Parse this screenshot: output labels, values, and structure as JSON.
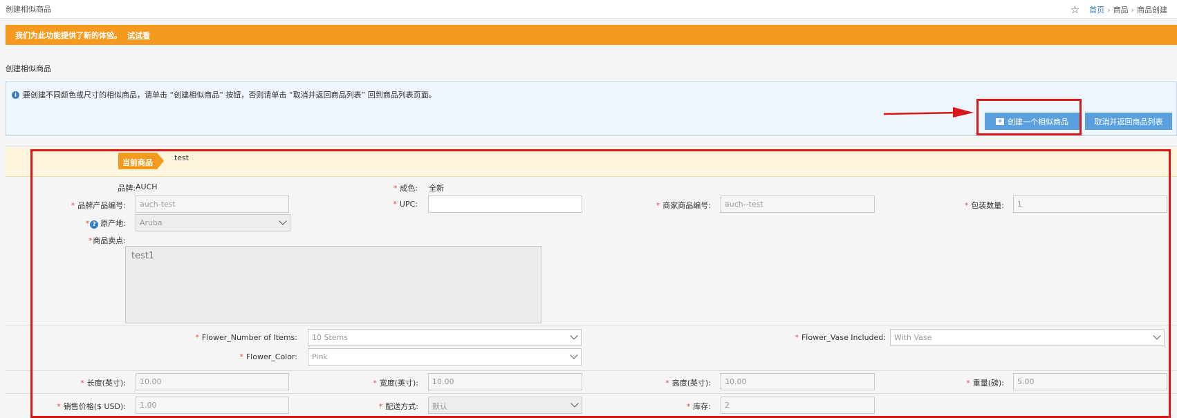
{
  "header": {
    "title": "创建相似商品",
    "breadcrumb": {
      "home": "首页",
      "sep1": "›",
      "level1": "商品",
      "sep2": "›",
      "level2": "商品创建"
    }
  },
  "banner": {
    "text": "我们为此功能提供了新的体验。",
    "link": "试试看"
  },
  "section_title": "创建相似商品",
  "info": {
    "text": "要创建不同颜色或尺寸的相似商品，请单击 “创建相似商品” 按钮，否则请单击 “取消并返回商品列表” 回到商品列表页面。",
    "create_button": "创建一个相似商品",
    "cancel_button": "取消并返回商品列表"
  },
  "current": {
    "tag": "当前商品",
    "name": "test"
  },
  "fields": {
    "brand": {
      "label": "品牌:",
      "value": "AUCH"
    },
    "condition": {
      "label": "成色:",
      "value": "全新"
    },
    "brand_code": {
      "label": "品牌产品编号:",
      "value": "auch-test"
    },
    "upc": {
      "label": "UPC:",
      "value": ""
    },
    "seller_sku": {
      "label": "商家商品编号:",
      "value": "auch--test"
    },
    "pack_qty": {
      "label": "包装数量:",
      "value": "1"
    },
    "origin": {
      "label": "原产地:",
      "value": "Aruba"
    },
    "selling_points": {
      "label": "商品卖点:",
      "value": "test1"
    },
    "flower_items": {
      "label": "Flower_Number of Items:",
      "value": "10 Stems"
    },
    "flower_vase": {
      "label": "Flower_Vase Included:",
      "value": "With Vase"
    },
    "flower_color": {
      "label": "Flower_Color:",
      "value": "Pink"
    },
    "length": {
      "label": "长度(英寸):",
      "value": "10.00"
    },
    "width": {
      "label": "宽度(英寸):",
      "value": "10.00"
    },
    "height": {
      "label": "高度(英寸):",
      "value": "10.00"
    },
    "weight": {
      "label": "重量(磅):",
      "value": "5.00"
    },
    "price": {
      "label": "销售价格($ USD):",
      "value": "1.00"
    },
    "shipping": {
      "label": "配送方式:",
      "value": "默认"
    },
    "stock": {
      "label": "库存:",
      "value": "2"
    }
  },
  "required_mark": "*",
  "colors": {
    "accent": "#f39a1f",
    "button": "#5aa0df",
    "annotation": "#d81818"
  }
}
